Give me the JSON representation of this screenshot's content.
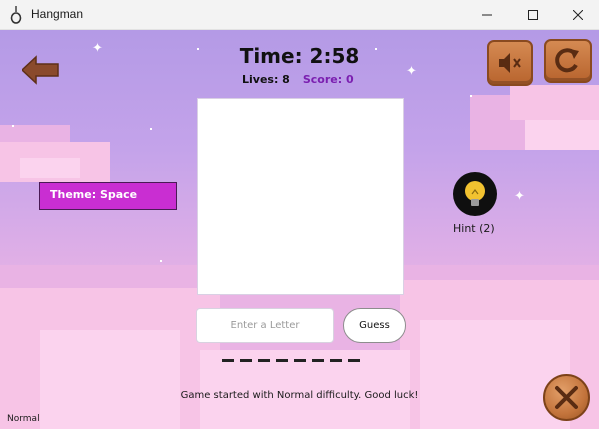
{
  "window": {
    "title": "Hangman",
    "icon": "noose-icon",
    "controls": [
      "minimize-icon",
      "maximize-icon",
      "close-icon"
    ]
  },
  "game": {
    "timer": "Time: 2:58",
    "lives": "Lives: 8",
    "score": "Score: 0",
    "theme": "Theme: Space",
    "hint": "Hint (2)",
    "input_placeholder": "Enter a Letter",
    "input_value": "",
    "guess_label": "Guess",
    "word_slots": 8,
    "message": "Game started with Normal difficulty. Good luck!",
    "difficulty": "Normal"
  },
  "icons": {
    "back": "arrow-left-icon",
    "mute": "speaker-muted-icon",
    "restart": "restart-icon",
    "hint": "lightbulb-icon",
    "close_game": "crossed-tools-icon"
  },
  "colors": {
    "theme_badge": "#c92ed2",
    "score_text": "#7b1fb0",
    "wood_button": "#c3743c",
    "sky_top": "#b49ae6",
    "sky_bottom": "#f0b8e2"
  }
}
